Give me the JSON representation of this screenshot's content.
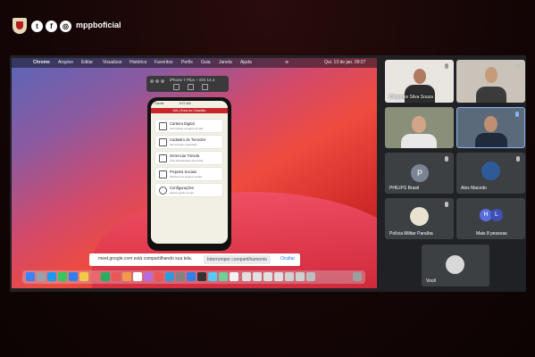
{
  "header": {
    "handle": "mppboficial",
    "social_icons": [
      "twitter-icon",
      "facebook-icon",
      "instagram-icon"
    ]
  },
  "mac_menu": [
    "Chrome",
    "Arquivo",
    "Editar",
    "Visualizar",
    "Histórico",
    "Favoritos",
    "Perfis",
    "Guia",
    "Janela",
    "Ajuda"
  ],
  "mac_clock": "Qui. 13 de jan. 09:27",
  "simulator": {
    "title": "iPhone 7 Plus – iOS 14.4"
  },
  "phone": {
    "status_left": "Carrier",
    "status_time": "9:27 AM",
    "header": "MA | Área do Cidadão",
    "cards": [
      {
        "title": "Carteira Digital",
        "sub": "Sua carteira na palma da mão"
      },
      {
        "title": "Cadastro de Torcedor",
        "sub": "Seu torcedor organizado"
      },
      {
        "title": "Gerenciar Torcida",
        "sub": "Área administrativa da torcida"
      },
      {
        "title": "Projetos Sociais",
        "sub": "Participe dos projetos sociais"
      },
      {
        "title": "Configurações",
        "sub": "Ajustes gerais do app"
      }
    ]
  },
  "share_bar": {
    "message": "meet.google.com está compartilhando sua tela.",
    "stop_label": "Interromper compartilhamento",
    "hide_label": "Ocultar"
  },
  "participants": [
    {
      "name": "Diógenes Silva Souza"
    },
    {
      "name": ""
    },
    {
      "name": ""
    },
    {
      "name": ""
    },
    {
      "name": "PHILIPS Brasil",
      "initial": "P"
    },
    {
      "name": "Alex Macedo"
    },
    {
      "name": "Polícia Militar Paraíba"
    },
    {
      "name": "Mais 8 pessoas",
      "initials": [
        "H",
        "L"
      ]
    },
    {
      "name": "Você"
    }
  ]
}
